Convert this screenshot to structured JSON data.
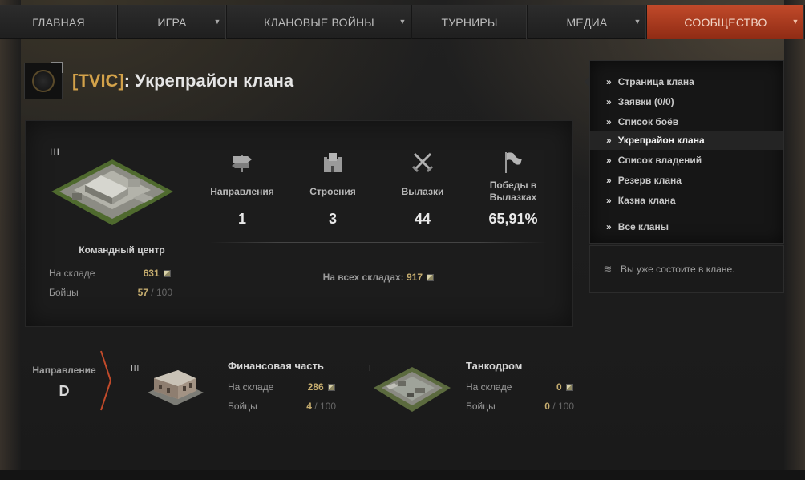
{
  "nav": {
    "items": [
      {
        "label": "ГЛАВНАЯ",
        "has_dropdown": false,
        "active": false
      },
      {
        "label": "ИГРА",
        "has_dropdown": true,
        "active": false
      },
      {
        "label": "КЛАНОВЫЕ ВОЙНЫ",
        "has_dropdown": true,
        "active": false
      },
      {
        "label": "ТУРНИРЫ",
        "has_dropdown": false,
        "active": false
      },
      {
        "label": "МЕДИА",
        "has_dropdown": true,
        "active": false
      },
      {
        "label": "СООБЩЕСТВО",
        "has_dropdown": true,
        "active": true
      }
    ]
  },
  "page": {
    "clan_tag": "[TVIC]",
    "title_separator": ":",
    "title": "Укрепрайон клана"
  },
  "hq": {
    "level": "III",
    "name": "Командный центр",
    "storage_label": "На складе",
    "storage_value": "631",
    "fighters_label": "Бойцы",
    "fighters_value": "57",
    "fighters_max": "/ 100"
  },
  "stats": [
    {
      "icon": "signpost-icon",
      "label": "Направления",
      "value": "1"
    },
    {
      "icon": "fortress-icon",
      "label": "Строения",
      "value": "3"
    },
    {
      "icon": "crossed-swords-icon",
      "label": "Вылазки",
      "value": "44"
    },
    {
      "icon": "flag-icon",
      "label": "Победы в Вылазках",
      "value": "65,91%"
    }
  ],
  "total": {
    "label": "На всех складах:",
    "value": "917"
  },
  "clan_menu": {
    "items": [
      {
        "label": "Страница клана",
        "active": false
      },
      {
        "label": "Заявки (0/0)",
        "active": false
      },
      {
        "label": "Список боёв",
        "active": false
      },
      {
        "label": "Укрепрайон клана",
        "active": true
      },
      {
        "label": "Список владений",
        "active": false
      },
      {
        "label": "Резерв клана",
        "active": false
      },
      {
        "label": "Казна клана",
        "active": false
      },
      {
        "label": "Все кланы",
        "active": false
      }
    ],
    "note": "Вы уже состоите в клане."
  },
  "direction": {
    "label": "Направление",
    "value": "D"
  },
  "buildings": [
    {
      "level": "III",
      "name": "Финансовая часть",
      "storage_label": "На складе",
      "storage_value": "286",
      "fighters_label": "Бойцы",
      "fighters_value": "4",
      "fighters_max": "/ 100"
    },
    {
      "level": "I",
      "name": "Танкодром",
      "storage_label": "На складе",
      "storage_value": "0",
      "fighters_label": "Бойцы",
      "fighters_value": "0",
      "fighters_max": "/ 100"
    }
  ],
  "colors": {
    "accent": "#c14a2a",
    "gold": "#c6ad6f",
    "clan_tag": "#d3a24a",
    "background": "#1b1b1b"
  }
}
